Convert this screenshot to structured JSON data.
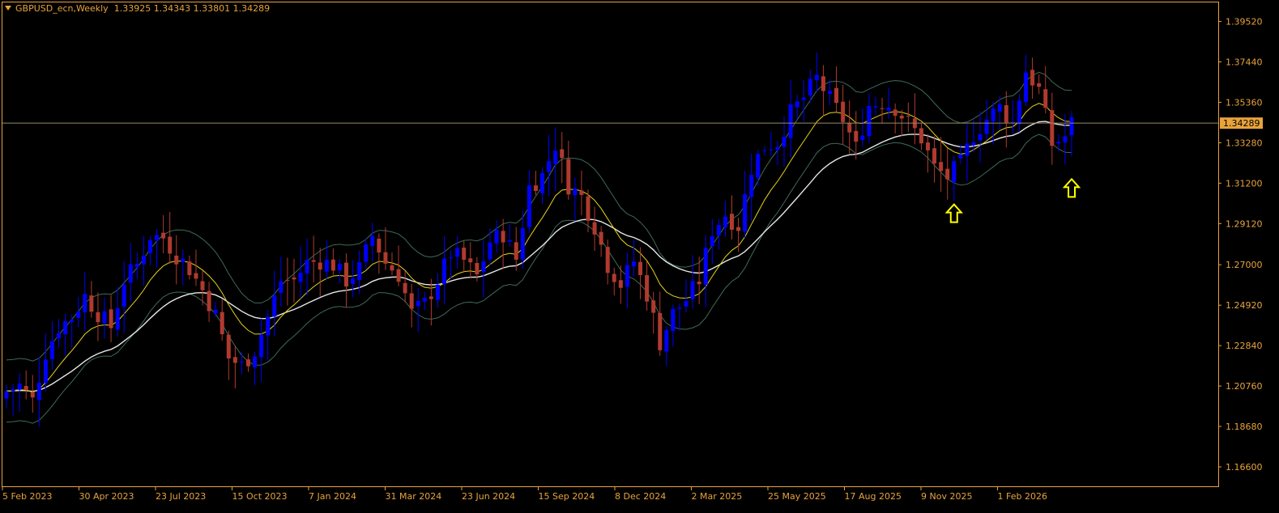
{
  "header": {
    "symbol": "GBPUSD_ecn,Weekly",
    "ohlc": "1.33925 1.34343 1.33801 1.34289"
  },
  "colors": {
    "background": "#000000",
    "frame": "#e8a33c",
    "text": "#e8a33c",
    "bull": "#0000ff",
    "bear": "#b03a2e",
    "ma_fast": "#e6d21a",
    "ma_slow": "#e6e6e6",
    "band": "#3f6b55",
    "arrow": "#ffff00",
    "price_label_bg": "#e8a33c",
    "price_label_text": "#000000"
  },
  "price_axis": {
    "ticks": [
      "1.39520",
      "1.37440",
      "1.35360",
      "1.33280",
      "1.31200",
      "1.29120",
      "1.27000",
      "1.24920",
      "1.22840",
      "1.20760",
      "1.18680",
      "1.16600"
    ],
    "current_price": "1.34289"
  },
  "time_axis": {
    "labels": [
      "5 Feb 2023",
      "30 Apr 2023",
      "23 Jul 2023",
      "15 Oct 2023",
      "7 Jan 2024",
      "31 Mar 2024",
      "23 Jun 2024",
      "15 Sep 2024",
      "8 Dec 2024",
      "2 Mar 2025",
      "25 May 2025",
      "17 Aug 2025",
      "9 Nov 2025",
      "1 Feb 2026"
    ]
  },
  "chart_data": {
    "type": "candlestick",
    "timeframe": "Weekly",
    "symbol": "GBPUSD_ecn",
    "ylim": [
      1.156,
      1.405
    ],
    "x_range": [
      "2023-02-05",
      "2026-03-22"
    ],
    "current_price": 1.34289,
    "close_anchors": [
      [
        "2023-02-05",
        1.205
      ],
      [
        "2023-02-19",
        1.208
      ],
      [
        "2023-03-05",
        1.2
      ],
      [
        "2023-03-19",
        1.225
      ],
      [
        "2023-04-02",
        1.238
      ],
      [
        "2023-04-16",
        1.243
      ],
      [
        "2023-04-30",
        1.254
      ],
      [
        "2023-05-14",
        1.245
      ],
      [
        "2023-05-28",
        1.238
      ],
      [
        "2023-06-11",
        1.262
      ],
      [
        "2023-06-25",
        1.27
      ],
      [
        "2023-07-09",
        1.285
      ],
      [
        "2023-07-23",
        1.284
      ],
      [
        "2023-08-06",
        1.275
      ],
      [
        "2023-08-20",
        1.268
      ],
      [
        "2023-09-03",
        1.257
      ],
      [
        "2023-09-17",
        1.244
      ],
      [
        "2023-10-01",
        1.222
      ],
      [
        "2023-10-15",
        1.218
      ],
      [
        "2023-10-29",
        1.226
      ],
      [
        "2023-11-12",
        1.243
      ],
      [
        "2023-11-26",
        1.262
      ],
      [
        "2023-12-10",
        1.262
      ],
      [
        "2023-12-24",
        1.271
      ],
      [
        "2024-01-07",
        1.272
      ],
      [
        "2024-01-21",
        1.27
      ],
      [
        "2024-02-04",
        1.262
      ],
      [
        "2024-02-18",
        1.268
      ],
      [
        "2024-03-03",
        1.285
      ],
      [
        "2024-03-17",
        1.271
      ],
      [
        "2024-03-31",
        1.265
      ],
      [
        "2024-04-14",
        1.245
      ],
      [
        "2024-04-28",
        1.25
      ],
      [
        "2024-05-12",
        1.262
      ],
      [
        "2024-05-26",
        1.276
      ],
      [
        "2024-06-09",
        1.272
      ],
      [
        "2024-06-23",
        1.264
      ],
      [
        "2024-07-07",
        1.282
      ],
      [
        "2024-07-21",
        1.286
      ],
      [
        "2024-08-04",
        1.273
      ],
      [
        "2024-08-18",
        1.31
      ],
      [
        "2024-09-01",
        1.316
      ],
      [
        "2024-09-15",
        1.332
      ],
      [
        "2024-09-29",
        1.311
      ],
      [
        "2024-10-13",
        1.305
      ],
      [
        "2024-10-27",
        1.29
      ],
      [
        "2024-11-10",
        1.27
      ],
      [
        "2024-11-24",
        1.26
      ],
      [
        "2024-12-08",
        1.272
      ],
      [
        "2024-12-22",
        1.255
      ],
      [
        "2025-01-05",
        1.23
      ],
      [
        "2025-01-19",
        1.245
      ],
      [
        "2025-02-02",
        1.252
      ],
      [
        "2025-02-16",
        1.262
      ],
      [
        "2025-03-02",
        1.288
      ],
      [
        "2025-03-16",
        1.296
      ],
      [
        "2025-03-30",
        1.29
      ],
      [
        "2025-04-13",
        1.32
      ],
      [
        "2025-04-27",
        1.331
      ],
      [
        "2025-05-11",
        1.333
      ],
      [
        "2025-05-25",
        1.348
      ],
      [
        "2025-06-08",
        1.356
      ],
      [
        "2025-06-22",
        1.366
      ],
      [
        "2025-07-06",
        1.355
      ],
      [
        "2025-07-20",
        1.345
      ],
      [
        "2025-08-03",
        1.33
      ],
      [
        "2025-08-17",
        1.352
      ],
      [
        "2025-08-31",
        1.354
      ],
      [
        "2025-09-14",
        1.351
      ],
      [
        "2025-09-28",
        1.343
      ],
      [
        "2025-10-12",
        1.335
      ],
      [
        "2025-10-26",
        1.32
      ],
      [
        "2025-11-09",
        1.315
      ],
      [
        "2025-11-23",
        1.322
      ],
      [
        "2025-12-07",
        1.337
      ],
      [
        "2025-12-21",
        1.345
      ],
      [
        "2026-01-04",
        1.351
      ],
      [
        "2026-01-18",
        1.343
      ],
      [
        "2026-02-01",
        1.37
      ],
      [
        "2026-02-15",
        1.36
      ],
      [
        "2026-03-01",
        1.332
      ],
      [
        "2026-03-15",
        1.336
      ],
      [
        "2026-03-22",
        1.343
      ]
    ],
    "indicators": [
      {
        "role": "fast moving average",
        "color": "#e6d21a"
      },
      {
        "role": "slow moving average",
        "color": "#e6e6e6"
      },
      {
        "role": "envelope band",
        "color": "#3f6b55"
      }
    ],
    "annotations": [
      {
        "type": "up-arrow",
        "date": "2025-11-16",
        "price": 1.2965,
        "color": "#ffff00"
      },
      {
        "type": "up-arrow",
        "date": "2026-03-22",
        "price": 1.3095,
        "color": "#ffff00"
      }
    ]
  }
}
